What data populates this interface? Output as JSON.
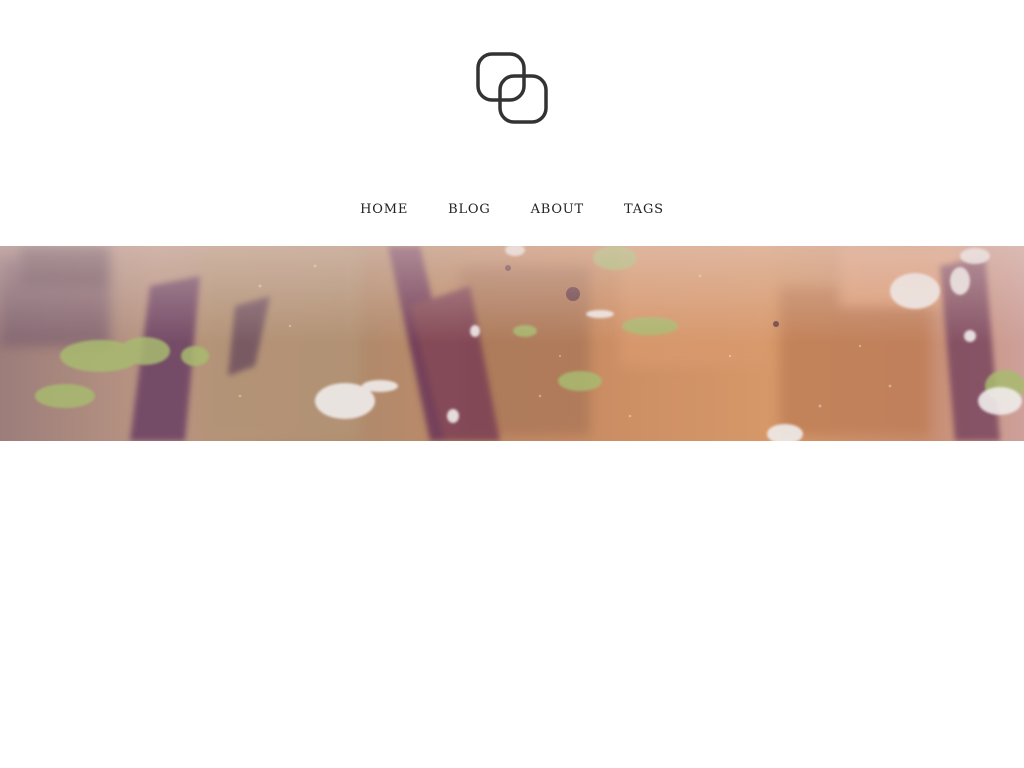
{
  "header": {
    "logo_icon": "overlapping-rounded-squares-icon",
    "logo_color": "#333333"
  },
  "nav": {
    "items": [
      {
        "label": "HOME"
      },
      {
        "label": "BLOG"
      },
      {
        "label": "ABOUT"
      },
      {
        "label": "TAGS"
      }
    ]
  },
  "hero": {
    "palette": {
      "base": "#c88c66",
      "warm": "#e0a07a",
      "purple": "#6b3a5a",
      "green": "#a8b870",
      "light": "#f2e6e0"
    }
  }
}
